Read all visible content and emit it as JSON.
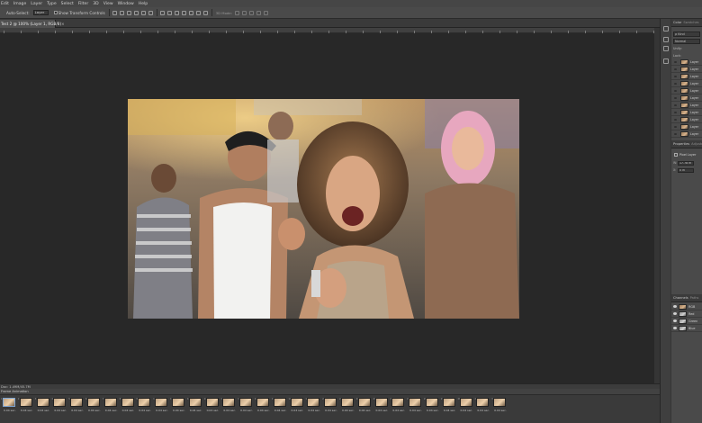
{
  "menu": [
    "Edit",
    "Image",
    "Layer",
    "Type",
    "Select",
    "Filter",
    "3D",
    "View",
    "Window",
    "Help"
  ],
  "options_bar": {
    "auto_select_label": "Auto-Select:",
    "auto_select_value": "Layer",
    "transform_controls_label": "Show Transform Controls",
    "mode_label": "3D Mode:"
  },
  "document_tab": {
    "title": "Test 2 @ 100% (Layer 1, RGB/8)",
    "close": "×"
  },
  "status_bar": {
    "text": "Doc: 1.49M/45.7M"
  },
  "right_panels": {
    "top_tabs": [
      "Color",
      "Swatches"
    ],
    "layers": {
      "kind_filter": "ρ Kind",
      "blend_mode": "Normal",
      "unify_label": "Unify:",
      "lock_label": "Lock:",
      "items": [
        "Layer",
        "Layer",
        "Layer",
        "Layer",
        "Layer",
        "Layer",
        "Layer",
        "Layer",
        "Layer",
        "Layer",
        "Layer"
      ]
    },
    "properties": {
      "tabs": [
        "Properties",
        "Adjustments"
      ],
      "type": "Pixel Layer",
      "w_label": "W:",
      "w_value": "17.78 in",
      "x_label": "X:",
      "x_value": "0 in"
    },
    "channels": {
      "tabs": [
        "Channels",
        "Paths"
      ],
      "items": [
        "RGB",
        "Red",
        "Green",
        "Blue"
      ]
    }
  },
  "timeline": {
    "label": "Frame Animation",
    "frame_duration": "0.04 sec.",
    "frame_count": 30,
    "selected_frame": 1
  },
  "colors": {
    "ui_bg": "#353535",
    "canvas_bg": "#282828",
    "accent": "#7fa6d4"
  }
}
